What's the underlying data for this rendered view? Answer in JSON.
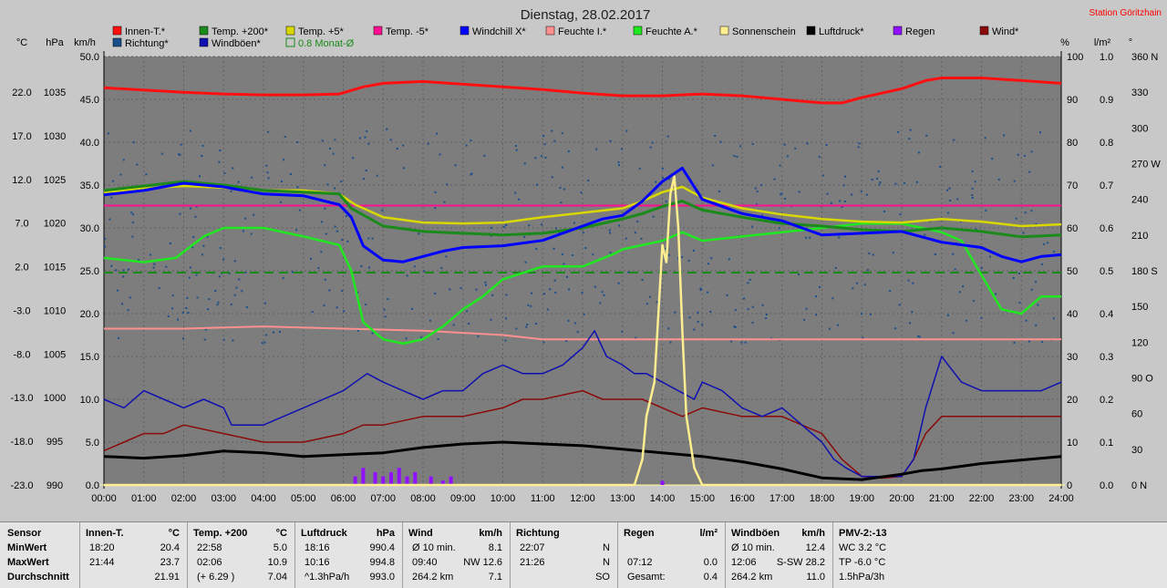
{
  "title": "Dienstag, 28.02.2017",
  "station": "Station Göritzhain",
  "colors": {
    "innen": "#ff1010",
    "richtung": "#1a4f8a",
    "temp200": "#1a8a1a",
    "windboeen": "#1010b0",
    "temp5": "#d8d800",
    "monat": "#1a8a1a",
    "tempm5": "#ff1090",
    "windchill": "#0000ff",
    "feuchteI": "#ff9090",
    "feuchteA": "#20e820",
    "sonne": "#ffee90",
    "luftdruck": "#000000",
    "regen": "#9010ff",
    "wind": "#8a0a0a",
    "plot_bg": "#7d7d7d",
    "bg": "#c8c8c8"
  },
  "legend": [
    {
      "label": "Innen-T.*",
      "color": "#ff1010"
    },
    {
      "label": "Temp. +200*",
      "color": "#1a8a1a"
    },
    {
      "label": "Temp. +5*",
      "color": "#d8d800"
    },
    {
      "label": "Temp. -5*",
      "color": "#ff1090"
    },
    {
      "label": "Windchill X*",
      "color": "#0000ff"
    },
    {
      "label": "Feuchte I.*",
      "color": "#ff9090"
    },
    {
      "label": "Feuchte A.*",
      "color": "#20e820"
    },
    {
      "label": "Sonnenschein",
      "color": "#ffee90"
    },
    {
      "label": "Luftdruck*",
      "color": "#000000"
    },
    {
      "label": "Regen",
      "color": "#9010ff"
    },
    {
      "label": "Wind*",
      "color": "#8a0a0a"
    },
    {
      "label": "Richtung*",
      "color": "#1a4f8a"
    },
    {
      "label": "Windböen*",
      "color": "#1010b0"
    },
    {
      "label": "0.8 Monat-Ø",
      "color": "#1a8a1a"
    }
  ],
  "axis_units": {
    "celsius": "°C",
    "hpa": "hPa",
    "kmh": "km/h",
    "percent": "%",
    "lm2": "l/m²",
    "degree": "°"
  },
  "chart_data": {
    "type": "line",
    "x": [
      "00:00",
      "01:00",
      "02:00",
      "03:00",
      "04:00",
      "05:00",
      "06:00",
      "07:00",
      "08:00",
      "09:00",
      "10:00",
      "11:00",
      "12:00",
      "13:00",
      "14:00",
      "15:00",
      "16:00",
      "17:00",
      "18:00",
      "19:00",
      "20:00",
      "21:00",
      "22:00",
      "23:00",
      "24:00"
    ],
    "axes": {
      "celsius": {
        "ticks": [
          "22.0",
          "17.0",
          "12.0",
          "7.0",
          "2.0",
          "-3.0",
          "-8.0",
          "-13.0",
          "-18.0",
          "-23.0"
        ],
        "range": [
          -23,
          25
        ]
      },
      "hpa": {
        "ticks": [
          "1035",
          "1030",
          "1025",
          "1020",
          "1015",
          "1010",
          "1005",
          "1000",
          "995",
          "990"
        ],
        "range": [
          990,
          1038
        ]
      },
      "kmh": {
        "ticks": [
          "50.0",
          "45.0",
          "40.0",
          "35.0",
          "30.0",
          "25.0",
          "20.0",
          "15.0",
          "10.0",
          "5.0",
          "0.0"
        ],
        "range": [
          0,
          50
        ]
      },
      "percent": {
        "ticks": [
          "100",
          "90",
          "80",
          "70",
          "60",
          "50",
          "40",
          "30",
          "20",
          "10",
          "0"
        ],
        "range": [
          0,
          100
        ]
      },
      "lm2": {
        "ticks": [
          "1.0",
          "0.9",
          "0.8",
          "0.7",
          "0.6",
          "0.5",
          "0.4",
          "0.3",
          "0.2",
          "0.1",
          "0.0"
        ],
        "range": [
          0,
          1
        ]
      },
      "direction": {
        "ticks": [
          "360 N",
          "330",
          "300",
          "270 W",
          "240",
          "210",
          "180 S",
          "150",
          "120",
          "90 O",
          "60",
          "30",
          "0 N"
        ],
        "range": [
          0,
          360
        ]
      }
    },
    "series": [
      {
        "name": "Innen-T.*",
        "key": "innen",
        "axis": "celsius",
        "x": [
          0,
          2,
          3,
          4,
          5,
          5.9,
          6.5,
          7,
          8,
          9,
          10,
          11,
          12,
          13,
          14,
          15,
          16,
          17,
          17.5,
          18,
          18.5,
          19,
          20,
          20.6,
          21,
          22,
          23,
          24
        ],
        "values": [
          21.5,
          21.0,
          20.8,
          20.7,
          20.7,
          20.8,
          21.6,
          22.0,
          22.2,
          21.9,
          21.6,
          21.3,
          20.9,
          20.6,
          20.6,
          20.8,
          20.6,
          20.2,
          20.0,
          19.8,
          19.8,
          20.4,
          21.4,
          22.3,
          22.6,
          22.6,
          22.3,
          22.0
        ]
      },
      {
        "name": "Feuchte I.*",
        "key": "feuchteI",
        "axis": "percent",
        "x": [
          0,
          2,
          4,
          6,
          8,
          10,
          11,
          12,
          13,
          14,
          16,
          18,
          20,
          21,
          22,
          24
        ],
        "values": [
          36.5,
          36.5,
          37,
          36.5,
          36,
          35,
          34,
          34,
          34,
          34,
          34,
          34,
          34,
          34,
          34,
          34
        ]
      },
      {
        "name": "Temp. -5*",
        "key": "tempm5",
        "axis": "celsius",
        "x": [
          0,
          24
        ],
        "values": [
          8.3,
          8.3
        ]
      },
      {
        "name": "0.8 Monat-Ø",
        "key": "monat",
        "axis": "celsius",
        "x": [
          0,
          24
        ],
        "values": [
          0.8,
          0.8
        ]
      },
      {
        "name": "Temp. +5*",
        "key": "temp5",
        "axis": "celsius",
        "x": [
          0,
          1,
          2,
          3,
          4,
          5,
          5.9,
          6.3,
          7,
          8,
          9,
          10,
          11,
          12,
          13,
          13.5,
          14,
          14.5,
          15,
          16,
          17,
          18,
          19,
          20,
          21,
          22,
          23,
          24
        ],
        "values": [
          9.8,
          10.2,
          10.5,
          10.3,
          10.0,
          10.0,
          9.6,
          8.4,
          7.0,
          6.4,
          6.3,
          6.4,
          7.0,
          7.5,
          8.0,
          8.8,
          9.8,
          10.4,
          9.2,
          8.0,
          7.3,
          6.8,
          6.5,
          6.4,
          6.8,
          6.5,
          6.0,
          6.2
        ]
      },
      {
        "name": "Temp. +200*",
        "key": "temp200",
        "axis": "celsius",
        "x": [
          0,
          1,
          2,
          3,
          4,
          5,
          5.9,
          6.2,
          7,
          8,
          9,
          10,
          11,
          12,
          13,
          13.5,
          14,
          14.5,
          15,
          16,
          17,
          18,
          19,
          20,
          21,
          22,
          23,
          24
        ],
        "values": [
          10.0,
          10.5,
          11.0,
          10.6,
          10.0,
          9.8,
          9.6,
          8.0,
          6.0,
          5.4,
          5.2,
          5.0,
          5.2,
          5.8,
          6.8,
          7.4,
          8.2,
          8.8,
          7.8,
          7.0,
          6.3,
          6.0,
          5.6,
          5.4,
          5.8,
          5.4,
          4.8,
          5.0
        ]
      },
      {
        "name": "Windchill X*",
        "key": "windchill",
        "axis": "celsius",
        "x": [
          0,
          1,
          2,
          3,
          4,
          5,
          5.9,
          6.2,
          6.5,
          7,
          7.5,
          8,
          8.5,
          9,
          10,
          11,
          12,
          12.5,
          13,
          13.5,
          14,
          14.5,
          15,
          16,
          17,
          18,
          19,
          20,
          21,
          22,
          22.5,
          23,
          23.5,
          24
        ],
        "values": [
          9.5,
          10.0,
          10.8,
          10.4,
          9.6,
          9.4,
          8.4,
          7.0,
          3.8,
          2.2,
          2.0,
          2.6,
          3.2,
          3.6,
          3.8,
          4.4,
          6.0,
          6.8,
          7.2,
          8.8,
          11.0,
          12.5,
          9.0,
          7.4,
          6.6,
          5.0,
          5.2,
          5.4,
          4.2,
          3.6,
          2.6,
          2.0,
          2.6,
          2.8
        ]
      },
      {
        "name": "Feuchte A.*",
        "key": "feuchteA",
        "axis": "percent",
        "x": [
          0,
          1,
          1.8,
          2.5,
          3,
          4,
          5,
          5.9,
          6.2,
          6.5,
          7,
          7.5,
          8,
          8.5,
          9,
          9.5,
          10,
          11,
          12,
          12.8,
          13,
          14,
          14.5,
          15,
          16,
          17,
          18,
          19,
          20,
          21,
          21.5,
          22,
          22.5,
          23,
          23.5,
          24
        ],
        "values": [
          53,
          52,
          53,
          58,
          60,
          60,
          58,
          56,
          50,
          38,
          34,
          33,
          34,
          37,
          41,
          44,
          48,
          51,
          51,
          54,
          55,
          57,
          59,
          57,
          58,
          59,
          60,
          61,
          61,
          59,
          57,
          49,
          41,
          40,
          44,
          44
        ]
      },
      {
        "name": "Windböen*",
        "key": "windboeen",
        "axis": "kmh",
        "x": [
          0,
          0.5,
          1,
          1.5,
          2,
          2.5,
          3,
          3.2,
          4,
          5,
          6,
          6.3,
          6.6,
          7,
          7.5,
          8,
          8.5,
          9,
          9.5,
          10,
          10.5,
          11,
          11.5,
          12,
          12.3,
          12.6,
          13,
          13.3,
          13.6,
          14,
          14.4,
          14.8,
          15,
          15.5,
          16,
          16.5,
          17,
          17.5,
          18,
          18.3,
          18.6,
          19,
          19.5,
          20,
          20.3,
          20.6,
          21,
          21.5,
          22,
          22.5,
          23,
          23.5,
          24
        ],
        "values": [
          10,
          9,
          11,
          10,
          9,
          10,
          9,
          7,
          7,
          9,
          11,
          12,
          13,
          12,
          11,
          10,
          11,
          11,
          13,
          14,
          13,
          13,
          14,
          16,
          18,
          15,
          14,
          13,
          13,
          12,
          11,
          10,
          12,
          11,
          9,
          8,
          9,
          7,
          5,
          3,
          2,
          1,
          1,
          1,
          3,
          9,
          15,
          12,
          11,
          11,
          11,
          11,
          12
        ]
      },
      {
        "name": "Wind*",
        "key": "wind",
        "axis": "kmh",
        "x": [
          0,
          0.5,
          1,
          1.5,
          2,
          3,
          4,
          5,
          6,
          6.5,
          7,
          8,
          9,
          10,
          10.5,
          11,
          12,
          12.5,
          13,
          13.5,
          14,
          14.5,
          15,
          16,
          17,
          18,
          18.5,
          19,
          19.5,
          20,
          20.3,
          20.6,
          21,
          21.5,
          22,
          22.5,
          23,
          23.5,
          24
        ],
        "values": [
          4,
          5,
          6,
          6,
          7,
          6,
          5,
          5,
          6,
          7,
          7,
          8,
          8,
          9,
          10,
          10,
          11,
          10,
          10,
          10,
          9,
          8,
          9,
          8,
          8,
          6,
          3,
          1,
          0.8,
          1,
          3,
          6,
          8,
          8,
          8,
          8,
          8,
          8,
          8
        ]
      },
      {
        "name": "Luftdruck*",
        "key": "luftdruck",
        "axis": "hpa",
        "x": [
          0,
          1,
          2,
          3,
          4,
          5,
          6,
          7,
          8,
          9,
          10,
          11,
          12,
          13,
          14,
          15,
          16,
          17,
          18,
          19,
          20,
          20.5,
          21,
          22,
          23,
          24
        ],
        "values": [
          993.2,
          993.0,
          993.3,
          993.8,
          993.6,
          993.2,
          993.4,
          993.6,
          994.2,
          994.6,
          994.8,
          994.6,
          994.4,
          994.0,
          993.6,
          993.2,
          992.6,
          991.8,
          990.8,
          990.6,
          991.2,
          991.6,
          991.8,
          992.4,
          992.8,
          993.2
        ]
      },
      {
        "name": "Sonnenschein",
        "key": "sonne",
        "axis": "kmh",
        "x": [
          0,
          13.3,
          13.5,
          13.6,
          13.8,
          14.0,
          14.1,
          14.2,
          14.3,
          14.4,
          14.5,
          14.6,
          14.8,
          15,
          24
        ],
        "values": [
          0,
          0,
          3,
          8,
          12,
          28,
          26,
          34,
          36,
          30,
          18,
          8,
          2,
          0,
          0
        ]
      },
      {
        "name": "Regen",
        "key": "regen",
        "axis": "lm2",
        "type": "bar",
        "x": [
          6.3,
          6.5,
          6.8,
          7.0,
          7.2,
          7.4,
          7.6,
          7.8,
          8.2,
          8.5,
          8.7,
          14.0
        ],
        "values": [
          0.02,
          0.04,
          0.03,
          0.02,
          0.03,
          0.04,
          0.02,
          0.03,
          0.02,
          0.01,
          0.02,
          0.01
        ]
      },
      {
        "name": "Richtung*",
        "key": "richtung",
        "axis": "direction",
        "type": "scatter",
        "note": "wind direction scatter points",
        "spread": [
          120,
          300
        ]
      }
    ]
  },
  "table": {
    "rows": [
      "Sensor",
      "MinWert",
      "MaxWert",
      "Durchschnitt"
    ],
    "columns": [
      {
        "head": "Innen-T.",
        "unit": "°C",
        "cells": [
          [
            "18:20",
            "20.4"
          ],
          [
            "21:44",
            "23.7"
          ],
          [
            "",
            "21.91"
          ]
        ]
      },
      {
        "head": "Temp. +200",
        "unit": "°C",
        "cells": [
          [
            "22:58",
            "5.0"
          ],
          [
            "02:06",
            "10.9"
          ],
          [
            "(+ 6.29 )",
            "7.04"
          ]
        ]
      },
      {
        "head": "Luftdruck",
        "unit": "hPa",
        "cells": [
          [
            "18:16",
            "990.4"
          ],
          [
            "10:16",
            "994.8"
          ],
          [
            "^1.3hPa/h",
            "993.0"
          ]
        ]
      },
      {
        "head": "Wind",
        "unit": "km/h",
        "cells": [
          [
            "Ø 10 min.",
            "8.1"
          ],
          [
            "09:40",
            "NW 12.6"
          ],
          [
            "264.2 km",
            "7.1"
          ]
        ]
      },
      {
        "head": "Richtung",
        "unit": "",
        "cells": [
          [
            "22:07",
            "N"
          ],
          [
            "21:26",
            "N"
          ],
          [
            "",
            "SO"
          ]
        ]
      },
      {
        "head": "Regen",
        "unit": "l/m²",
        "cells": [
          [
            "",
            ""
          ],
          [
            "07:12",
            "0.0"
          ],
          [
            "Gesamt:",
            "0.4"
          ]
        ]
      },
      {
        "head": "Windböen",
        "unit": "km/h",
        "cells": [
          [
            "Ø 10 min.",
            "12.4"
          ],
          [
            "12:06",
            "S-SW 28.2"
          ],
          [
            "264.2 km",
            "11.0"
          ]
        ]
      },
      {
        "head": "PMV-2:-13",
        "unit": "",
        "cells": [
          [
            "WC 3.2 °C",
            ""
          ],
          [
            "TP -6.0 °C",
            ""
          ],
          [
            "1.5hPa/3h",
            ""
          ]
        ]
      }
    ]
  }
}
